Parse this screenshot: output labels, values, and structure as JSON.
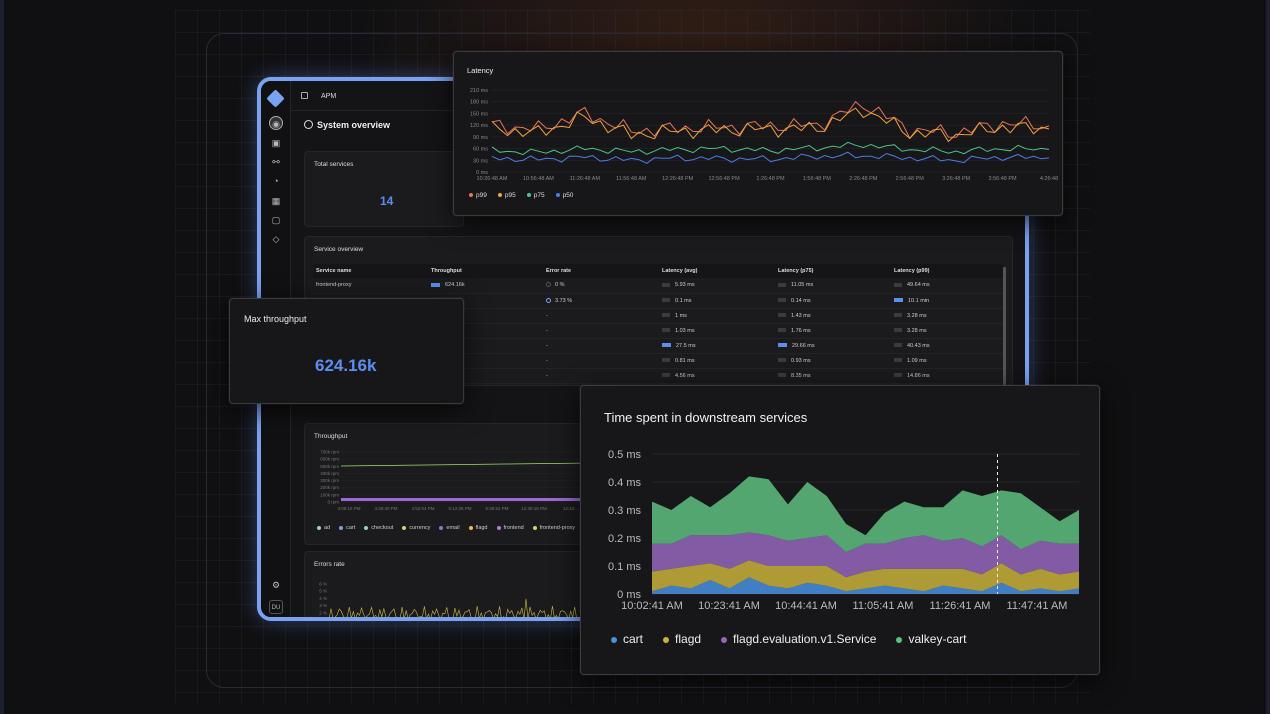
{
  "app": {
    "section": "APM",
    "page_title": "System overview"
  },
  "sidebar": {
    "icons": [
      "dashboard-icon",
      "layers-icon",
      "nodes-icon",
      "bell-icon",
      "grid-icon",
      "box-icon",
      "shield-icon"
    ],
    "bottom": [
      "settings-icon"
    ],
    "avatar": "DU"
  },
  "total_services": {
    "label": "Total services",
    "value": "14"
  },
  "max_throughput": {
    "label": "Max throughput",
    "value": "624.16k"
  },
  "service_overview": {
    "title": "Service overview",
    "columns": [
      "Service name",
      "Throughput",
      "Error rate",
      "Latency (avg)",
      "Latency (p75)",
      "Latency (p99)"
    ],
    "rows": [
      {
        "name": "frontend-proxy",
        "throughput": "624.16k",
        "error": "0 %",
        "avg": "5.93 ms",
        "p75": "11.05 ms",
        "p99": "49.64 ms"
      },
      {
        "name": "",
        "throughput": "",
        "error": "3.73 %",
        "avg": "0.1 ms",
        "p75": "0.14 ms",
        "p99": "10.1 min"
      },
      {
        "name": "",
        "throughput": "",
        "error": "-",
        "avg": "1 ms",
        "p75": "1.43 ms",
        "p99": "3.28 ms"
      },
      {
        "name": "",
        "throughput": "",
        "error": "-",
        "avg": "1.03 ms",
        "p75": "1.76 ms",
        "p99": "3.28 ms"
      },
      {
        "name": "",
        "throughput": "",
        "error": "-",
        "avg": "27.5 ms",
        "p75": "29.66 ms",
        "p99": "40.43 ms"
      },
      {
        "name": "",
        "throughput": "",
        "error": "-",
        "avg": "0.81 ms",
        "p75": "0.93 ms",
        "p99": "1.09 ms"
      },
      {
        "name": "",
        "throughput": "",
        "error": "-",
        "avg": "4.56 ms",
        "p75": "8.35 ms",
        "p99": "14.86 ms"
      }
    ]
  },
  "throughput_panel": {
    "title": "Throughput",
    "y_ticks": [
      "700k rpm",
      "600k rpm",
      "500k rpm",
      "400k rpm",
      "300k rpm",
      "200k rpm",
      "100k rpm",
      "0 rpm"
    ],
    "x_ticks": [
      "4:08:15 PM",
      "4:28:40 PM",
      "4:52:04 PM",
      "5:12:28 PM",
      "5:36:52 PM",
      "12:36:16 PM",
      "12:42:..."
    ],
    "legend": [
      "ad",
      "cart",
      "checkout",
      "currency",
      "email",
      "flagd",
      "frontend",
      "frontend-proxy"
    ]
  },
  "errors_panel": {
    "title": "Errors rate",
    "y_ticks": [
      "6 %",
      "5 %",
      "4 %",
      "3 %",
      "2 %",
      "1 %"
    ]
  },
  "latency_panel": {
    "title": "Latency",
    "y_ticks": [
      "210 ms",
      "180 ms",
      "150 ms",
      "120 ms",
      "90 ms",
      "60 ms",
      "30 ms",
      "0 ms"
    ],
    "x_ticks": [
      "10:26:48 AM",
      "10:56:48 AM",
      "11:26:48 AM",
      "11:56:48 AM",
      "12:26:48 PM",
      "12:56:48 PM",
      "1:26:48 PM",
      "1:56:48 PM",
      "2:26:48 PM",
      "2:56:48 PM",
      "3:26:48 PM",
      "3:56:48 PM",
      "4:26:48"
    ],
    "legend": [
      "p99",
      "p95",
      "p75",
      "p50"
    ]
  },
  "downstream_panel": {
    "title": "Time spent in downstream services",
    "y_ticks": [
      "0.5 ms",
      "0.4 ms",
      "0.3 ms",
      "0.2 ms",
      "0.1 ms",
      "0 ms"
    ],
    "x_ticks": [
      "10:02:41 AM",
      "10:23:41 AM",
      "10:44:41 AM",
      "11:05:41 AM",
      "11:26:41 AM",
      "11:47:41 AM"
    ],
    "legend": [
      "cart",
      "flagd",
      "flagd.evaluation.v1.Service",
      "valkey-cart"
    ]
  },
  "colors": {
    "accent": "#5b8ef0",
    "p99": "#e8735a",
    "p95": "#f2a33a",
    "p75": "#4cc38a",
    "p50": "#4f7be8",
    "cart": "#4a90e2",
    "flagd": "#c9b33c",
    "flagd_eval": "#9467bd",
    "valkey": "#5fbf80"
  },
  "chart_data": [
    {
      "type": "line",
      "title": "Latency",
      "xlabel": "",
      "ylabel": "",
      "ylim": [
        0,
        210
      ],
      "x": [
        "10:26:48 AM",
        "10:56:48 AM",
        "11:26:48 AM",
        "11:56:48 AM",
        "12:26:48 PM",
        "12:56:48 PM",
        "1:26:48 PM",
        "1:56:48 PM",
        "2:26:48 PM",
        "2:56:48 PM",
        "3:26:48 PM",
        "3:56:48 PM",
        "4:26:48"
      ],
      "series": [
        {
          "name": "p99",
          "values": [
            120,
            110,
            150,
            105,
            112,
            115,
            118,
            120,
            175,
            108,
            100,
            125,
            118
          ]
        },
        {
          "name": "p95",
          "values": [
            110,
            100,
            140,
            95,
            105,
            108,
            110,
            112,
            160,
            100,
            95,
            115,
            110
          ]
        },
        {
          "name": "p75",
          "values": [
            55,
            50,
            60,
            52,
            58,
            60,
            55,
            62,
            70,
            58,
            52,
            60,
            58
          ]
        },
        {
          "name": "p50",
          "values": [
            35,
            32,
            38,
            30,
            36,
            34,
            33,
            40,
            42,
            36,
            30,
            38,
            36
          ]
        }
      ],
      "legend": "bottom-left",
      "grid": true
    },
    {
      "type": "area",
      "title": "Time spent in downstream services",
      "xlabel": "",
      "ylabel": "",
      "ylim": [
        0,
        0.5
      ],
      "stacked": true,
      "x": [
        "10:02:41 AM",
        "10:07:56 AM",
        "10:13:11 AM",
        "10:18:26 AM",
        "10:23:41 AM",
        "10:28:56 AM",
        "10:34:11 AM",
        "10:39:26 AM",
        "10:44:41 AM",
        "10:49:56 AM",
        "10:55:11 AM",
        "11:00:26 AM",
        "11:05:41 AM",
        "11:10:56 AM",
        "11:16:11 AM",
        "11:21:26 AM",
        "11:26:41 AM",
        "11:31:56 AM",
        "11:37:11 AM",
        "11:42:26 AM",
        "11:47:41 AM",
        "11:52:56 AM",
        "11:58:11 AM"
      ],
      "series": [
        {
          "name": "cart",
          "values": [
            0.01,
            0.03,
            0.02,
            0.05,
            0.02,
            0.06,
            0.03,
            0.02,
            0.04,
            0.03,
            0.01,
            0.02,
            0.03,
            0.02,
            0.01,
            0.03,
            0.02,
            0.01,
            0.04,
            0.01,
            0.02,
            0.01,
            0.02
          ]
        },
        {
          "name": "flagd",
          "values": [
            0.07,
            0.06,
            0.08,
            0.06,
            0.07,
            0.06,
            0.07,
            0.08,
            0.06,
            0.07,
            0.05,
            0.06,
            0.06,
            0.07,
            0.08,
            0.06,
            0.07,
            0.06,
            0.07,
            0.06,
            0.07,
            0.06,
            0.06
          ]
        },
        {
          "name": "flagd.evaluation.v1.Service",
          "values": [
            0.1,
            0.09,
            0.11,
            0.1,
            0.12,
            0.1,
            0.11,
            0.09,
            0.1,
            0.11,
            0.09,
            0.1,
            0.09,
            0.11,
            0.12,
            0.1,
            0.11,
            0.1,
            0.1,
            0.09,
            0.1,
            0.11,
            0.1
          ]
        },
        {
          "name": "valkey-cart",
          "values": [
            0.15,
            0.12,
            0.14,
            0.1,
            0.15,
            0.2,
            0.2,
            0.13,
            0.2,
            0.14,
            0.1,
            0.03,
            0.11,
            0.13,
            0.1,
            0.12,
            0.17,
            0.18,
            0.16,
            0.2,
            0.12,
            0.08,
            0.12
          ]
        }
      ],
      "legend": "bottom-left",
      "grid": true
    }
  ]
}
